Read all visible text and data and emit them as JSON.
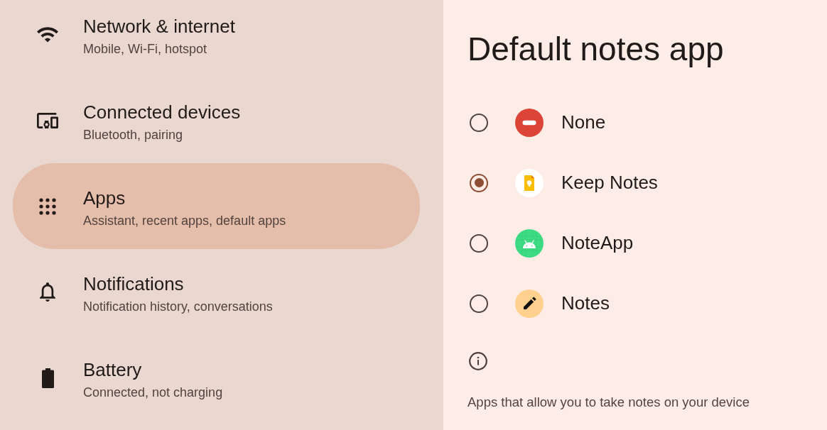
{
  "settings_list": {
    "items": [
      {
        "title": "Network & internet",
        "subtitle": "Mobile, Wi-Fi, hotspot",
        "selected": false
      },
      {
        "title": "Connected devices",
        "subtitle": "Bluetooth, pairing",
        "selected": false
      },
      {
        "title": "Apps",
        "subtitle": "Assistant, recent apps, default apps",
        "selected": true
      },
      {
        "title": "Notifications",
        "subtitle": "Notification history, conversations",
        "selected": false
      },
      {
        "title": "Battery",
        "subtitle": "Connected, not charging",
        "selected": false
      }
    ]
  },
  "detail": {
    "title": "Default notes app",
    "options": [
      {
        "label": "None",
        "selected": false
      },
      {
        "label": "Keep Notes",
        "selected": true
      },
      {
        "label": "NoteApp",
        "selected": false
      },
      {
        "label": "Notes",
        "selected": false
      }
    ],
    "footer": "Apps that allow you to take notes on your device"
  }
}
